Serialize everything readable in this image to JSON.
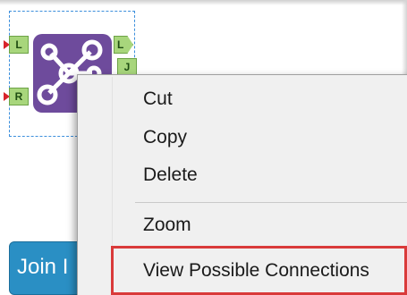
{
  "tool": {
    "icon_name": "join-tool-icon",
    "color": "#6e4b9c",
    "input_anchors": [
      "L",
      "R"
    ],
    "output_anchors": [
      "L",
      "J"
    ]
  },
  "join_tool": {
    "label": "Join I",
    "color": "#2a8fc4"
  },
  "context_menu": {
    "items": [
      {
        "label": "Cut"
      },
      {
        "label": "Copy"
      },
      {
        "label": "Delete"
      },
      {
        "label": "Zoom"
      },
      {
        "label": "View Possible Connections"
      }
    ],
    "highlight_color": "#d93a3a"
  }
}
